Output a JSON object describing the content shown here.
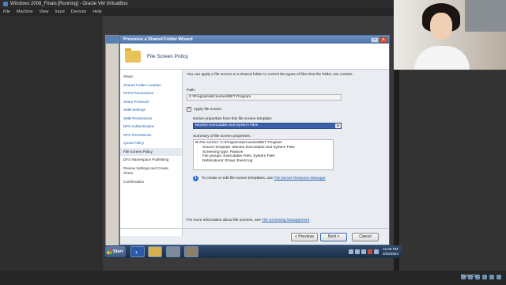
{
  "vbox": {
    "title": "Windows 2008_Finals [Running] - Oracle VM VirtualBox",
    "menu": [
      "File",
      "Machine",
      "View",
      "Input",
      "Devices",
      "Help"
    ]
  },
  "webcam": {
    "label": "Right Ctrl"
  },
  "dialog": {
    "title": "Provision a Shared Folder Wizard",
    "header_title": "File Screen Policy",
    "steps": [
      {
        "label": "Steps:",
        "type": "head"
      },
      {
        "label": "Shared Folder Location",
        "type": "link"
      },
      {
        "label": "NTFS Permissions",
        "type": "link"
      },
      {
        "label": "Share Protocols",
        "type": "link"
      },
      {
        "label": "SMB Settings",
        "type": "link"
      },
      {
        "label": "SMB Permissions",
        "type": "link"
      },
      {
        "label": "NFS Authentication",
        "type": "link"
      },
      {
        "label": "NFS Permissions",
        "type": "link"
      },
      {
        "label": "Quota Policy",
        "type": "link"
      },
      {
        "label": "File Screen Policy",
        "type": "active"
      },
      {
        "label": "DFS Namespace Publishing",
        "type": "plain"
      },
      {
        "label": "Review Settings and Create Share",
        "type": "plain"
      },
      {
        "label": "Confirmation",
        "type": "plain"
      }
    ],
    "description": "You can apply a file screen to a shared folder to control the types of files that the folder can contain.",
    "path_label": "Path:",
    "path_value": "C:\\Programs&Courses\\BET Program",
    "apply_checkbox_label": "Apply file screen",
    "apply_checked": true,
    "derive_label": "Derive properties from this file screen template:",
    "template_selected": "Monitor Executable and System Files",
    "summary_label": "Summary of file screen properties:",
    "summary": [
      {
        "text": "File screen: C:\\Programs&Courses\\BET Program",
        "indent": false
      },
      {
        "text": "Source template: Monitor Executable and System Files",
        "indent": true
      },
      {
        "text": "Screening type: Passive",
        "indent": true
      },
      {
        "text": "File groups: Executable Files, System Files",
        "indent": true
      },
      {
        "text": "Notifications: Email, Event log",
        "indent": true
      }
    ],
    "info_text": "To create or edit file screen templates, use ",
    "info_link": "File Server Resource Manager",
    "more_info_text": "For more information about file screens, see ",
    "more_info_link": "File Screening Management",
    "buttons": {
      "previous": "< Previous",
      "next": "Next >",
      "cancel": "Cancel"
    }
  },
  "taskbar": {
    "start_label": "Start",
    "time": "11:06 PM",
    "date": "3/30/2024"
  },
  "colors": {
    "title_gradient": "#4c72a8",
    "link": "#1f5db0",
    "selected_template_bg": "#3b5fa8"
  }
}
